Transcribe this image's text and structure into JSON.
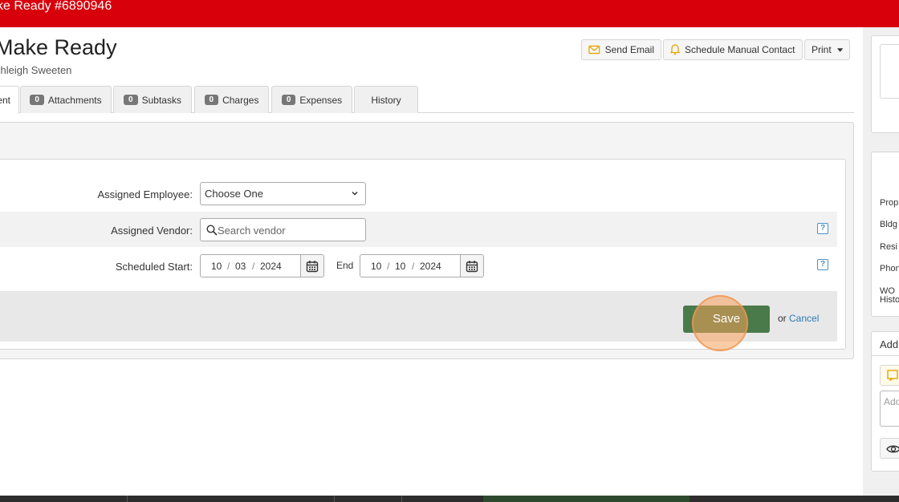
{
  "header": {
    "title": "ke Ready #6890946"
  },
  "page": {
    "title": "Make Ready",
    "subtitle": "shleigh Sweeten"
  },
  "actions": {
    "send_email": "Send Email",
    "schedule_contact": "Schedule Manual Contact",
    "print": "Print"
  },
  "tabs": [
    {
      "label": "ent",
      "active": true
    },
    {
      "count": "0",
      "label": "Attachments"
    },
    {
      "count": "0",
      "label": "Subtasks"
    },
    {
      "count": "0",
      "label": "Charges"
    },
    {
      "count": "0",
      "label": "Expenses"
    },
    {
      "label": "History"
    }
  ],
  "form": {
    "assigned_employee_label": "Assigned Employee:",
    "assigned_employee_value": "Choose One",
    "assigned_vendor_label": "Assigned Vendor:",
    "vendor_placeholder": "Search vendor",
    "scheduled_start_label": "Scheduled Start:",
    "start_date": {
      "month": "10",
      "day": "03",
      "year": "2024"
    },
    "end_label": "End",
    "end_date": {
      "month": "10",
      "day": "10",
      "year": "2024"
    },
    "help": "?"
  },
  "footer": {
    "save_label": "Save",
    "or_text": "or",
    "cancel_label": "Cancel"
  },
  "right_panel": {
    "labels": [
      "Prop",
      "Bldg",
      "Resi",
      "Phon",
      "WO",
      "Histo"
    ],
    "add_label": "Add",
    "note_placeholder": "Ado"
  },
  "colors": {
    "brand_red": "#d7000b",
    "save_green": "#4a7a4a",
    "link_blue": "#2a7ab8"
  }
}
